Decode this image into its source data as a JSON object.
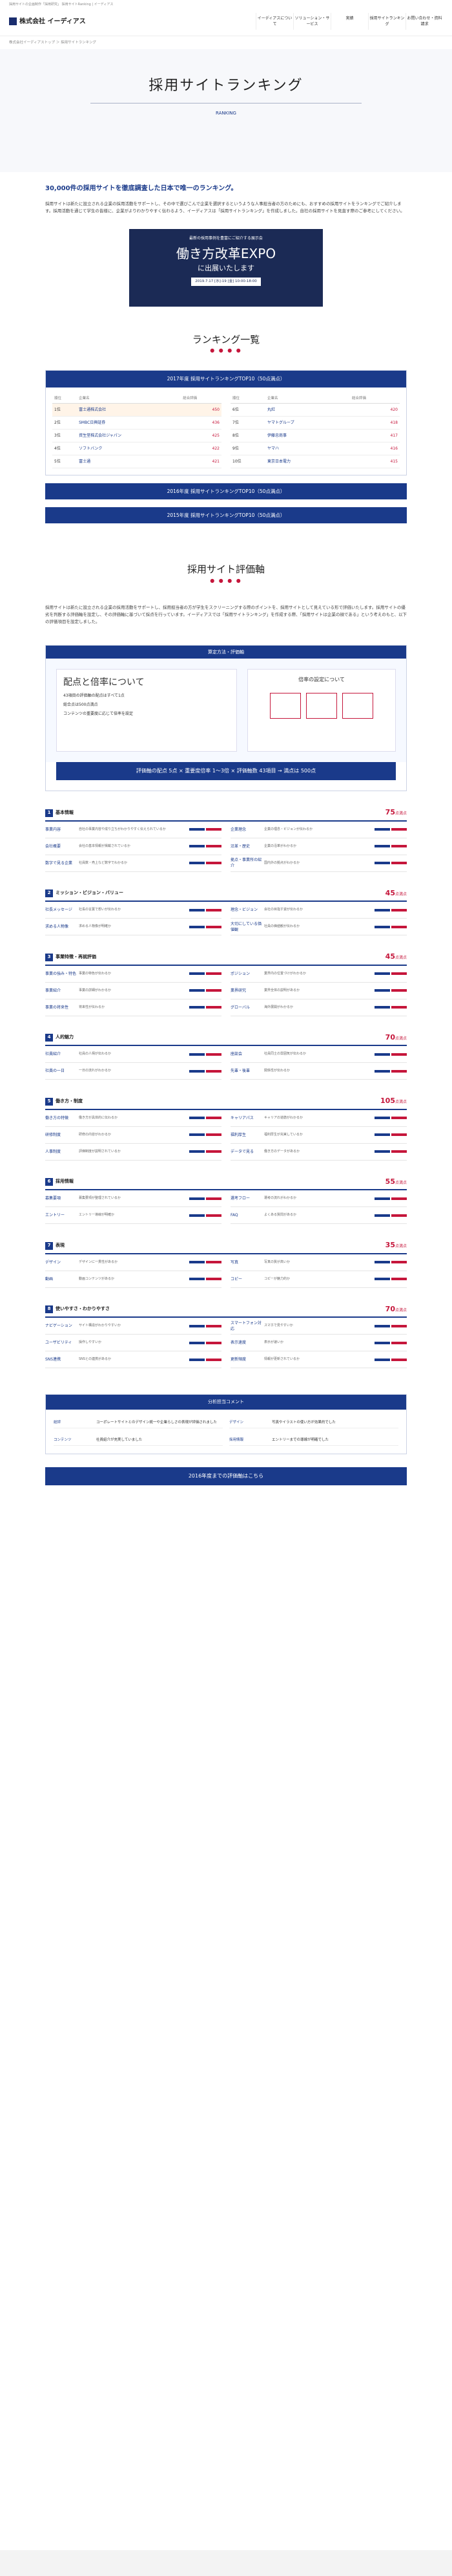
{
  "top_note": "採用サイトの企画制作「採用研究」 採用サイトRanking | イーディアス",
  "header": {
    "logo": "株式会社 イーディアス",
    "nav": [
      "イーディアスについて",
      "ソリューション・サービス",
      "実績",
      "採用サイトランキング",
      "お問い合わせ・資料請求"
    ]
  },
  "breadcrumb": "株式会社イーディアストップ ＞ 採用サイトランキング",
  "hero": {
    "title": "採用サイトランキング",
    "subtitle": "RANKING"
  },
  "lead": {
    "heading": "30,000件の採用サイトを徹底調査した日本で唯一のランキング。",
    "body": "採用サイトは新たに設立される企業の採用活動をサポートし、その中で選びこんで企業を選択するというような人事担当者の方のためにも、おすすめの採用サイトをランキングでご紹介します。採用活動を通じて学生の皆様に、企業がよりわかりやすく伝わるよう、イーディアスは「採用サイトランキング」を作成しました。自社の採用サイトを見直す際のご参考にしてください。"
  },
  "expo": {
    "t1": "最新の採用事例を豊富にご紹介する展示会",
    "t2": "働き方改革EXPO",
    "t3": "に出展いたします",
    "t4": "2019.7.17 [水]-19 [金] 10:00-18:00"
  },
  "ranking_section": {
    "title": "ランキング一覧",
    "dots": "● ● ● ●"
  },
  "rank2017": {
    "head": "2017年度 採用サイトランキングTOP10（50点満点）",
    "col_headers": [
      "順位",
      "企業名",
      "総合評価"
    ],
    "left": [
      {
        "rank": "1位",
        "name": "富士通株式会社",
        "score": "450"
      },
      {
        "rank": "2位",
        "name": "SMBC日興証券",
        "score": "436"
      },
      {
        "rank": "3位",
        "name": "資生堂株式会社ジャパン",
        "score": "425"
      },
      {
        "rank": "4位",
        "name": "ソフトバンク",
        "score": "422"
      },
      {
        "rank": "5位",
        "name": "富士通",
        "score": "421"
      }
    ],
    "right": [
      {
        "rank": "6位",
        "name": "丸紅",
        "score": "420"
      },
      {
        "rank": "7位",
        "name": "ヤマトグループ",
        "score": "418"
      },
      {
        "rank": "8位",
        "name": "伊藤忠商事",
        "score": "417"
      },
      {
        "rank": "9位",
        "name": "ヤマハ",
        "score": "416"
      },
      {
        "rank": "10位",
        "name": "東京日本電力",
        "score": "415"
      }
    ]
  },
  "year_buttons": [
    "2016年度 採用サイトランキングTOP10（50点満点）",
    "2015年度 採用サイトランキングTOP10（50点満点）"
  ],
  "eval_section": {
    "title": "採用サイト評価軸",
    "dots": "● ● ● ●"
  },
  "intro": "採用サイトは新たに設立される企業の採用活動をサポートし、採用担当者の方が学生をスクリーニングする際のポイントを、採用サイトとして見えている形で評価いたします。採用サイトの優劣を判断する評価軸を設定し、その評価軸に基づいて採点を行っています。イーディアスでは「採用サイトランキング」を作成する際、「採用サイトは企業の顔である」という考えのもと、以下の評価項目を設定しました。",
  "method": {
    "head": "算定方法・評価軸",
    "left_title": "配点と倍率について",
    "left_items": [
      "43項目の評価軸の配点はすべて1点",
      "総合点は500点満点",
      "コンテンツの重要度に応じて倍率を設定"
    ],
    "right_title": "倍率の設定について",
    "calc": "評価軸の配点 5点 × 重要度倍率 1〜3倍 × 評価軸数 43項目 → 満点は 500点"
  },
  "categories": [
    {
      "no": "1",
      "name": "基本情報",
      "pts": "75",
      "unit": "点満点",
      "items": [
        {
          "k": "事業内容",
          "d": "自社の事業内容や成り立ちがわかりやすく伝えられているか"
        },
        {
          "k": "企業理念",
          "d": "企業の理念・ビジョンが伝わるか"
        },
        {
          "k": "会社概要",
          "d": "会社の基本情報が掲載されているか"
        },
        {
          "k": "沿革・歴史",
          "d": "企業の沿革がわかるか"
        },
        {
          "k": "数字で見る企業",
          "d": "社員数・売上など数字でわかるか"
        },
        {
          "k": "拠点・事業所の紹介",
          "d": "国内外の拠点がわかるか"
        }
      ]
    },
    {
      "no": "2",
      "name": "ミッション・ビジョン・バリュー",
      "pts": "45",
      "unit": "点満点",
      "items": [
        {
          "k": "社長メッセージ",
          "d": "社長の言葉で想いが伝わるか"
        },
        {
          "k": "理念・ビジョン",
          "d": "会社の目指す姿が伝わるか"
        },
        {
          "k": "求める人物像",
          "d": "求める人物像が明確か"
        },
        {
          "k": "大切にしている価値観",
          "d": "社員の価値観が伝わるか"
        }
      ]
    },
    {
      "no": "3",
      "name": "事業特徴・再就評価",
      "pts": "45",
      "unit": "点満点",
      "items": [
        {
          "k": "事業の強み・特色",
          "d": "事業の特色が伝わるか"
        },
        {
          "k": "ポジション",
          "d": "業界内の位置づけがわかるか"
        },
        {
          "k": "事業紹介",
          "d": "事業の詳細がわかるか"
        },
        {
          "k": "業界研究",
          "d": "業界全体の説明があるか"
        },
        {
          "k": "事業の将来性",
          "d": "将来性が伝わるか"
        },
        {
          "k": "グローバル",
          "d": "海外展開がわかるか"
        }
      ]
    },
    {
      "no": "4",
      "name": "人的魅力",
      "pts": "70",
      "unit": "点満点",
      "items": [
        {
          "k": "社員紹介",
          "d": "社員の人柄が伝わるか"
        },
        {
          "k": "座談会",
          "d": "社員同士の雰囲気が伝わるか"
        },
        {
          "k": "社員の一日",
          "d": "一日の流れがわかるか"
        },
        {
          "k": "先輩・後輩",
          "d": "関係性が伝わるか"
        }
      ]
    },
    {
      "no": "5",
      "name": "働き方・制度",
      "pts": "105",
      "unit": "点満点",
      "items": [
        {
          "k": "働き方の特徴",
          "d": "働き方が具体的に伝わるか"
        },
        {
          "k": "キャリアパス",
          "d": "キャリアの道筋がわかるか"
        },
        {
          "k": "研修制度",
          "d": "研修の内容がわかるか"
        },
        {
          "k": "福利厚生",
          "d": "福利厚生が充実しているか"
        },
        {
          "k": "人事制度",
          "d": "評価制度が説明されているか"
        },
        {
          "k": "データで見る",
          "d": "働き方のデータがあるか"
        }
      ]
    },
    {
      "no": "6",
      "name": "採用情報",
      "pts": "55",
      "unit": "点満点",
      "items": [
        {
          "k": "募集要項",
          "d": "募集要項が整理されているか"
        },
        {
          "k": "選考フロー",
          "d": "選考の流れがわかるか"
        },
        {
          "k": "エントリー",
          "d": "エントリー導線が明確か"
        },
        {
          "k": "FAQ",
          "d": "よくある質問があるか"
        }
      ]
    },
    {
      "no": "7",
      "name": "表現",
      "pts": "35",
      "unit": "点満点",
      "items": [
        {
          "k": "デザイン",
          "d": "デザインに一貫性があるか"
        },
        {
          "k": "写真",
          "d": "写真の質が高いか"
        },
        {
          "k": "動画",
          "d": "動画コンテンツがあるか"
        },
        {
          "k": "コピー",
          "d": "コピーが魅力的か"
        }
      ]
    },
    {
      "no": "8",
      "name": "使いやすさ・わかりやすさ",
      "pts": "70",
      "unit": "点満点",
      "items": [
        {
          "k": "ナビゲーション",
          "d": "サイト構造がわかりやすいか"
        },
        {
          "k": "スマートフォン対応",
          "d": "スマホで見やすいか"
        },
        {
          "k": "ユーザビリティ",
          "d": "操作しやすいか"
        },
        {
          "k": "表示速度",
          "d": "表示が速いか"
        },
        {
          "k": "SNS連携",
          "d": "SNSとの連携があるか"
        },
        {
          "k": "更新頻度",
          "d": "情報が更新されているか"
        }
      ]
    }
  ],
  "analysis": {
    "head": "分析担当コメント",
    "rows": [
      {
        "k": "総評",
        "d": "コーポレートサイトとのデザイン統一や企業らしさの表現が評価されました"
      },
      {
        "k": "デザイン",
        "d": "写真やイラストの使い方が効果的でした"
      },
      {
        "k": "コンテンツ",
        "d": "社員紹介が充実していました"
      },
      {
        "k": "採用情報",
        "d": "エントリーまでの導線が明確でした"
      }
    ]
  },
  "footer_button": "2016年度までの評価軸はこちら"
}
